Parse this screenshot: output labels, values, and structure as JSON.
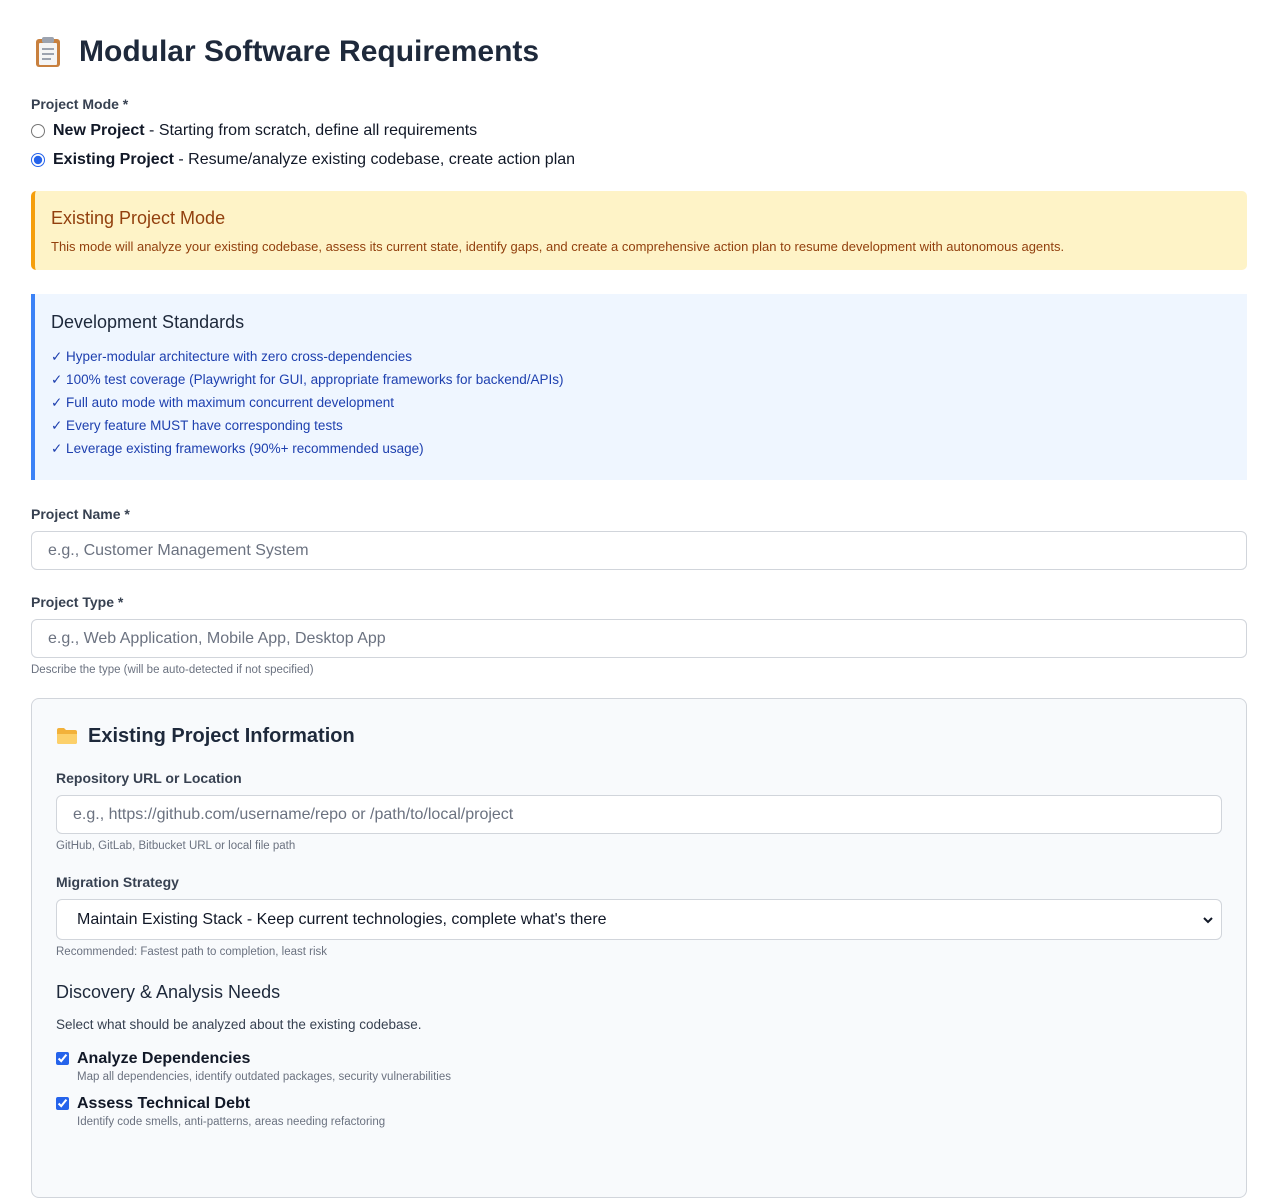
{
  "header": {
    "title": "Modular Software Requirements",
    "icon": "clipboard-icon"
  },
  "project_mode": {
    "label": "Project Mode *",
    "options": [
      {
        "name": "New Project",
        "desc": " - Starting from scratch, define all requirements",
        "selected": false
      },
      {
        "name": "Existing Project",
        "desc": " - Resume/analyze existing codebase, create action plan",
        "selected": true
      }
    ]
  },
  "alert": {
    "title": "Existing Project Mode",
    "text": "This mode will analyze your existing codebase, assess its current state, identify gaps, and create a comprehensive action plan to resume development with autonomous agents."
  },
  "standards": {
    "title": "Development Standards",
    "items": [
      "✓ Hyper-modular architecture with zero cross-dependencies",
      "✓ 100% test coverage (Playwright for GUI, appropriate frameworks for backend/APIs)",
      "✓ Full auto mode with maximum concurrent development",
      "✓ Every feature MUST have corresponding tests",
      "✓ Leverage existing frameworks (90%+ recommended usage)"
    ]
  },
  "project_name": {
    "label": "Project Name *",
    "placeholder": "e.g., Customer Management System",
    "value": ""
  },
  "project_type": {
    "label": "Project Type *",
    "placeholder": "e.g., Web Application, Mobile App, Desktop App",
    "value": "",
    "hint": "Describe the type (will be auto-detected if not specified)"
  },
  "existing": {
    "title": "Existing Project Information",
    "icon": "folder-icon",
    "repo": {
      "label": "Repository URL or Location",
      "placeholder": "e.g., https://github.com/username/repo or /path/to/local/project",
      "hint": "GitHub, GitLab, Bitbucket URL or local file path"
    },
    "migration": {
      "label": "Migration Strategy",
      "selected": "Maintain Existing Stack - Keep current technologies, complete what's there",
      "hint": "Recommended: Fastest path to completion, least risk"
    },
    "discovery": {
      "title": "Discovery & Analysis Needs",
      "subtitle": "Select what should be analyzed about the existing codebase.",
      "items": [
        {
          "name": "Analyze Dependencies",
          "desc": "Map all dependencies, identify outdated packages, security vulnerabilities",
          "checked": true
        },
        {
          "name": "Assess Technical Debt",
          "desc": "Identify code smells, anti-patterns, areas needing refactoring",
          "checked": true
        }
      ]
    }
  },
  "colors": {
    "accent": "#2563eb",
    "alert_bg": "#fef3c7",
    "alert_border": "#f59e0b",
    "info_bg": "#eff6ff",
    "info_border": "#3b82f6"
  }
}
